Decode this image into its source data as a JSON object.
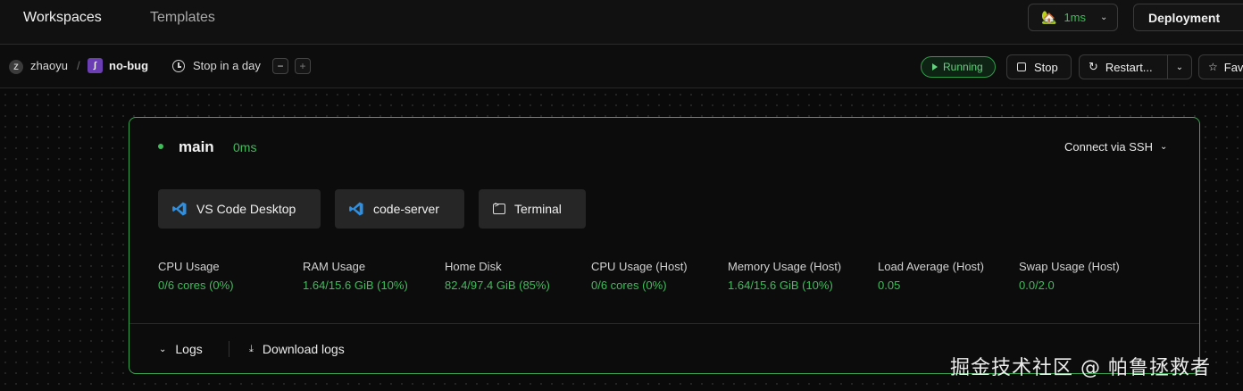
{
  "nav": {
    "workspaces": "Workspaces",
    "templates": "Templates"
  },
  "latency_menu": {
    "icon": "house-emoji-icon",
    "value": "1ms"
  },
  "deployment_menu": {
    "label": "Deployment"
  },
  "workspace": {
    "owner_initial": "Z",
    "owner": "zhaoyu",
    "separator": "/",
    "name": "no-bug",
    "schedule": "Stop in a day",
    "minus": "−",
    "plus": "+"
  },
  "actions": {
    "status": "Running",
    "stop": "Stop",
    "restart": "Restart...",
    "favorite": "Fav"
  },
  "agent": {
    "name": "main",
    "latency": "0ms",
    "ssh": "Connect via SSH",
    "apps": [
      "VS Code Desktop",
      "code-server",
      "Terminal"
    ],
    "stats": [
      {
        "label": "CPU Usage",
        "value": "0/6 cores (0%)"
      },
      {
        "label": "RAM Usage",
        "value": "1.64/15.6 GiB (10%)"
      },
      {
        "label": "Home Disk",
        "value": "82.4/97.4 GiB (85%)"
      },
      {
        "label": "CPU Usage (Host)",
        "value": "0/6 cores (0%)"
      },
      {
        "label": "Memory Usage (Host)",
        "value": "1.64/15.6 GiB (10%)"
      },
      {
        "label": "Load Average (Host)",
        "value": "0.05"
      },
      {
        "label": "Swap Usage (Host)",
        "value": "0.0/2.0"
      }
    ],
    "logs": "Logs",
    "download_logs": "Download logs"
  },
  "colors": {
    "accent_green": "#3fbd5b",
    "background": "#0b0b0b",
    "border_green": "#3aa552"
  },
  "watermark": "掘金技术社区 @ 帕鲁拯救者"
}
